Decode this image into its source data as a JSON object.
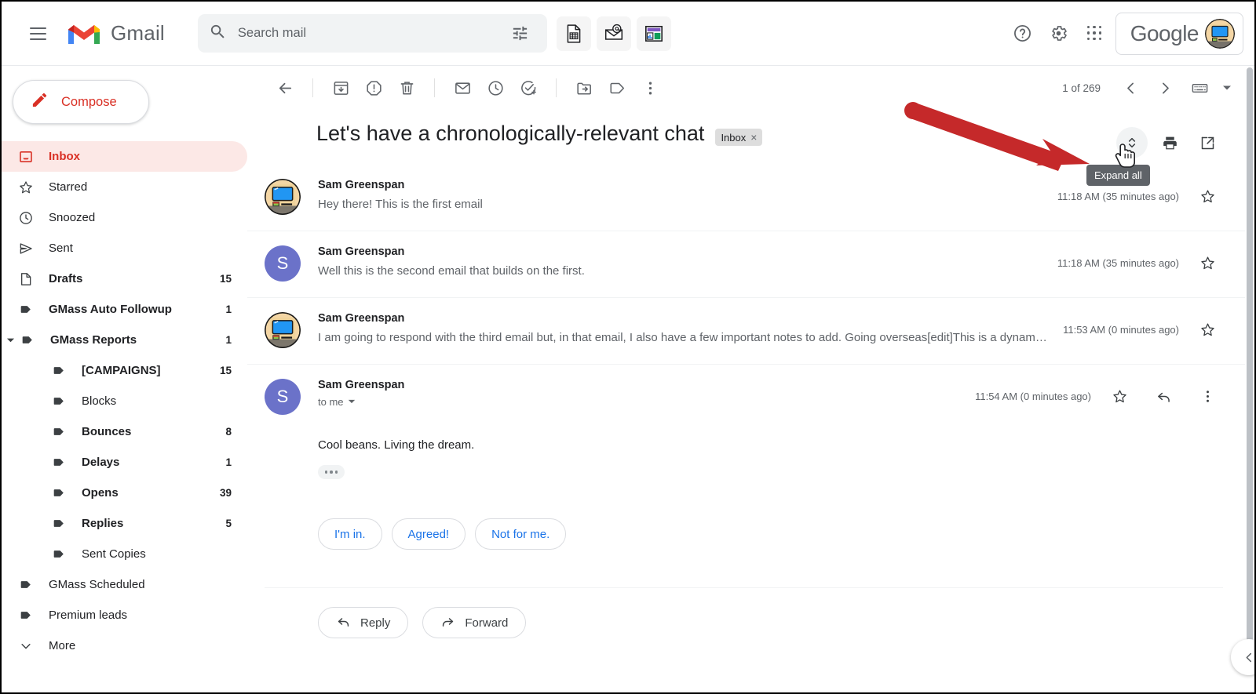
{
  "app": {
    "name": "Gmail"
  },
  "search": {
    "placeholder": "Search mail",
    "value": ""
  },
  "topbar": {
    "menu_label": "Main menu",
    "gmass_tools": [
      {
        "name": "gmass-sheets-icon",
        "label": "Build email list from Google Sheets"
      },
      {
        "name": "gmass-email-icon",
        "label": "GMass settings"
      },
      {
        "name": "gmass-dashboard-icon",
        "label": "GMass dashboard"
      }
    ],
    "help_label": "Support",
    "settings_label": "Settings",
    "apps_label": "Google apps",
    "account_word": "Google"
  },
  "sidebar": {
    "compose_label": "Compose",
    "items": [
      {
        "label": "Inbox",
        "count": "",
        "icon": "inbox-icon",
        "selected": true,
        "bold": true,
        "indent": 0
      },
      {
        "label": "Starred",
        "count": "",
        "icon": "star-icon",
        "selected": false,
        "bold": false,
        "indent": 0
      },
      {
        "label": "Snoozed",
        "count": "",
        "icon": "clock-icon",
        "selected": false,
        "bold": false,
        "indent": 0
      },
      {
        "label": "Sent",
        "count": "",
        "icon": "send-icon",
        "selected": false,
        "bold": false,
        "indent": 0
      },
      {
        "label": "Drafts",
        "count": "15",
        "icon": "draft-icon",
        "selected": false,
        "bold": true,
        "indent": 0
      },
      {
        "label": "GMass Auto Followup",
        "count": "1",
        "icon": "label-icon",
        "selected": false,
        "bold": true,
        "indent": 0
      },
      {
        "label": "GMass Reports",
        "count": "1",
        "icon": "label-icon",
        "selected": false,
        "bold": true,
        "indent": 0,
        "expanded": true
      },
      {
        "label": "[CAMPAIGNS]",
        "count": "15",
        "icon": "label-icon",
        "selected": false,
        "bold": true,
        "indent": 1
      },
      {
        "label": "Blocks",
        "count": "",
        "icon": "label-icon",
        "selected": false,
        "bold": false,
        "indent": 1
      },
      {
        "label": "Bounces",
        "count": "8",
        "icon": "label-icon",
        "selected": false,
        "bold": true,
        "indent": 1
      },
      {
        "label": "Delays",
        "count": "1",
        "icon": "label-icon",
        "selected": false,
        "bold": true,
        "indent": 1
      },
      {
        "label": "Opens",
        "count": "39",
        "icon": "label-icon",
        "selected": false,
        "bold": true,
        "indent": 1
      },
      {
        "label": "Replies",
        "count": "5",
        "icon": "label-icon",
        "selected": false,
        "bold": true,
        "indent": 1
      },
      {
        "label": "Sent Copies",
        "count": "",
        "icon": "label-icon",
        "selected": false,
        "bold": false,
        "indent": 1
      },
      {
        "label": "GMass Scheduled",
        "count": "",
        "icon": "label-icon",
        "selected": false,
        "bold": false,
        "indent": 0
      },
      {
        "label": "Premium leads",
        "count": "",
        "icon": "label-icon",
        "selected": false,
        "bold": false,
        "indent": 0
      },
      {
        "label": "More",
        "count": "",
        "icon": "chevron-down-icon",
        "selected": false,
        "bold": false,
        "indent": 0
      }
    ]
  },
  "toolbar": {
    "back_label": "Back to Inbox",
    "archive_label": "Archive",
    "spam_label": "Report spam",
    "delete_label": "Delete",
    "unread_label": "Mark as unread",
    "snooze_label": "Snooze",
    "tasks_label": "Add to Tasks",
    "move_label": "Move to",
    "labels_label": "Labels",
    "more_label": "More",
    "page_count": "1 of 269",
    "prev_label": "Older",
    "next_label": "Newer",
    "keyboard_label": "Input tools"
  },
  "thread": {
    "subject": "Let's have a chronologically-relevant chat",
    "label_chip": "Inbox",
    "chip_remove": "×",
    "expand_all_label": "Expand all",
    "print_label": "Print all",
    "popout_label": "Open in new window",
    "messages": [
      {
        "sender": "Sam Greenspan",
        "preview": "Hey there! This is the first email",
        "time": "11:18 AM (35 minutes ago)",
        "avatar_type": "photo",
        "avatar_letter": "",
        "expanded": false
      },
      {
        "sender": "Sam Greenspan",
        "preview": "Well this is the second email that builds on the first.",
        "time": "11:18 AM (35 minutes ago)",
        "avatar_type": "letter",
        "avatar_letter": "S",
        "expanded": false
      },
      {
        "sender": "Sam Greenspan",
        "preview": "I am going to respond with the third email but, in that email, I also have a few important notes to add. Going overseas[edit]This is a dynamic list and may…",
        "time": "11:53 AM (0 minutes ago)",
        "avatar_type": "photo",
        "avatar_letter": "",
        "expanded": false
      }
    ],
    "open_message": {
      "sender": "Sam Greenspan",
      "to_line": "to me",
      "time": "11:54 AM (0 minutes ago)",
      "body": "Cool beans. Living the dream.",
      "avatar_letter": "S",
      "trimmed_label": "Show trimmed content",
      "star_label": "Not starred",
      "reply_icon_label": "Reply",
      "more_label": "More"
    },
    "smart_replies": [
      "I'm in.",
      "Agreed!",
      "Not for me."
    ],
    "reply_label": "Reply",
    "forward_label": "Forward"
  },
  "annotation": {
    "arrow_color": "#c5292a"
  },
  "colors": {
    "accent_red": "#d93025",
    "selected_bg": "#fce8e6",
    "avatar_purple": "#6b72c9",
    "link_blue": "#1a73e8",
    "text_primary": "#202124",
    "text_secondary": "#5f6368"
  },
  "footer": {
    "collapse_label": "Hide side panel"
  }
}
